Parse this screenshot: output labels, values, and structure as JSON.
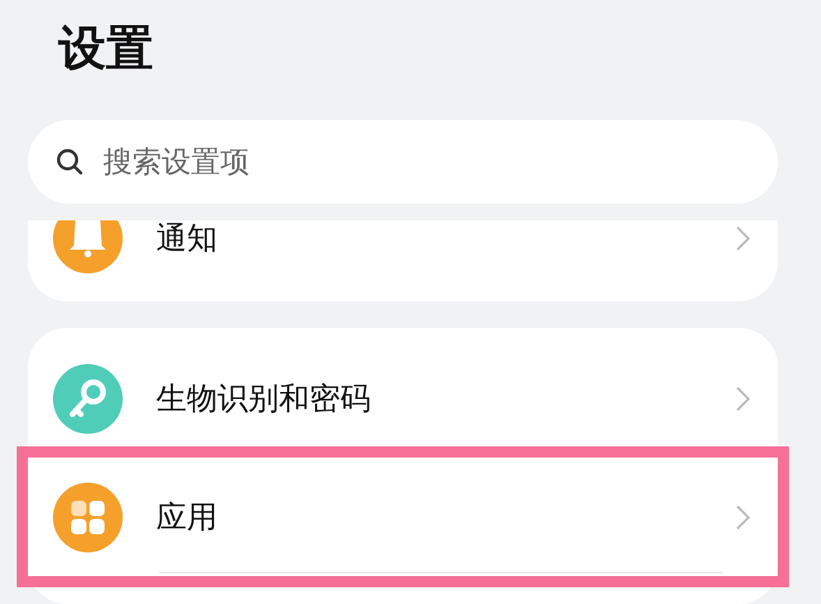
{
  "title": "设置",
  "search": {
    "placeholder": "搜索设置项"
  },
  "groups": [
    {
      "clipped": true,
      "items": [
        {
          "label": "通知",
          "kind": "bell",
          "highlighted": false
        }
      ]
    },
    {
      "clipped": false,
      "items": [
        {
          "label": "生物识别和密码",
          "kind": "key",
          "highlighted": false
        },
        {
          "label": "应用",
          "kind": "apps",
          "highlighted": true
        }
      ]
    }
  ]
}
